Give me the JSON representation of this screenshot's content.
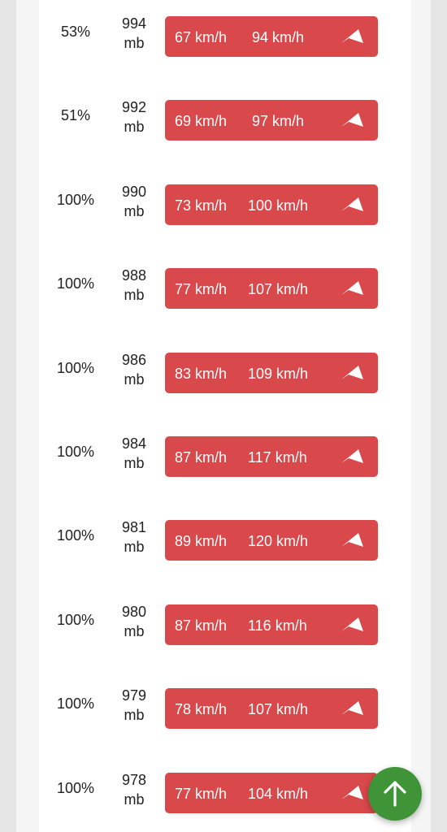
{
  "rows": [
    {
      "humidity": "53%",
      "pressure_value": "994",
      "pressure_unit": "mb",
      "wind_speed": "67 km/h",
      "wind_gust": "94 km/h"
    },
    {
      "humidity": "51%",
      "pressure_value": "992",
      "pressure_unit": "mb",
      "wind_speed": "69 km/h",
      "wind_gust": "97 km/h"
    },
    {
      "humidity": "100%",
      "pressure_value": "990",
      "pressure_unit": "mb",
      "wind_speed": "73 km/h",
      "wind_gust": "100 km/h"
    },
    {
      "humidity": "100%",
      "pressure_value": "988",
      "pressure_unit": "mb",
      "wind_speed": "77 km/h",
      "wind_gust": "107 km/h"
    },
    {
      "humidity": "100%",
      "pressure_value": "986",
      "pressure_unit": "mb",
      "wind_speed": "83 km/h",
      "wind_gust": "109 km/h"
    },
    {
      "humidity": "100%",
      "pressure_value": "984",
      "pressure_unit": "mb",
      "wind_speed": "87 km/h",
      "wind_gust": "117 km/h"
    },
    {
      "humidity": "100%",
      "pressure_value": "981",
      "pressure_unit": "mb",
      "wind_speed": "89 km/h",
      "wind_gust": "120 km/h"
    },
    {
      "humidity": "100%",
      "pressure_value": "980",
      "pressure_unit": "mb",
      "wind_speed": "87 km/h",
      "wind_gust": "116 km/h"
    },
    {
      "humidity": "100%",
      "pressure_value": "979",
      "pressure_unit": "mb",
      "wind_speed": "78 km/h",
      "wind_gust": "107 km/h"
    },
    {
      "humidity": "100%",
      "pressure_value": "978",
      "pressure_unit": "mb",
      "wind_speed": "77 km/h",
      "wind_gust": "104 km/h"
    }
  ],
  "icons": {
    "wind_direction": "wind-direction-arrow-icon",
    "scroll_top": "arrow-up-icon"
  },
  "colors": {
    "wind_pill": "#d9484a",
    "fab": "#3e9436"
  }
}
